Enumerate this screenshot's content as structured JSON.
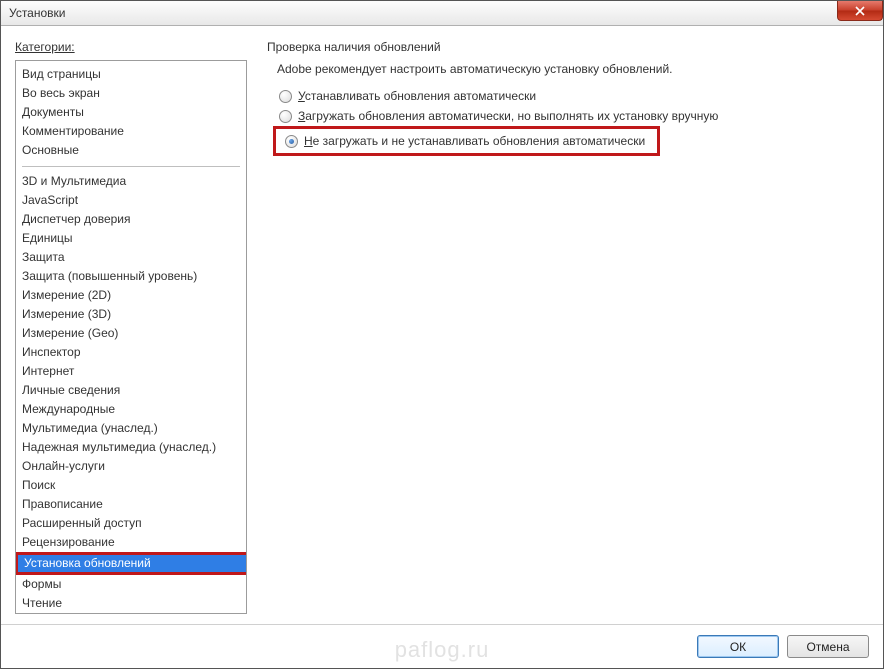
{
  "window": {
    "title": "Установки"
  },
  "sidebar": {
    "label": "Категории:",
    "group1": [
      "Вид страницы",
      "Во весь экран",
      "Документы",
      "Комментирование",
      "Основные"
    ],
    "group2": [
      "3D и Мультимедиа",
      "JavaScript",
      "Диспетчер доверия",
      "Единицы",
      "Защита",
      "Защита (повышенный уровень)",
      "Измерение (2D)",
      "Измерение (3D)",
      "Измерение (Geo)",
      "Инспектор",
      "Интернет",
      "Личные сведения",
      "Международные",
      "Мультимедиа (унаслед.)",
      "Надежная мультимедиа (унаслед.)",
      "Онлайн-услуги",
      "Поиск",
      "Правописание",
      "Расширенный доступ",
      "Рецензирование",
      "Установка обновлений",
      "Формы",
      "Чтение"
    ],
    "selected": "Установка обновлений"
  },
  "main": {
    "section_title": "Проверка наличия обновлений",
    "description": "Adobe рекомендует настроить автоматическую установку обновлений.",
    "options": [
      {
        "prefix": "У",
        "rest": "станавливать обновления автоматически",
        "checked": false
      },
      {
        "prefix": "З",
        "rest": "агружать обновления автоматически, но выполнять их установку вручную",
        "checked": false
      },
      {
        "prefix": "Н",
        "rest": "е загружать и не устанавливать обновления автоматически",
        "checked": true
      }
    ]
  },
  "footer": {
    "ok": "ОК",
    "cancel": "Отмена"
  },
  "watermark": "paflog.ru"
}
